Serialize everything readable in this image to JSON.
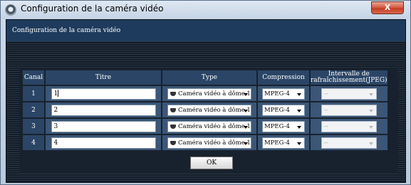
{
  "window": {
    "title": "Configuration de la caméra vidéo",
    "close_label": "X"
  },
  "page": {
    "title": "Configuration de la caméra vidéo"
  },
  "table": {
    "headers": {
      "canal": "Canal",
      "titre": "Titre",
      "type": "Type",
      "compression": "Compression",
      "intervalle": "Intervalle de rafraîchissement(JPEG)"
    },
    "rows": [
      {
        "canal": "1",
        "titre": "1",
        "type": "Caméra vidéo à dôme 1",
        "compression": "MPEG-4",
        "intervalle": "--"
      },
      {
        "canal": "2",
        "titre": "2",
        "type": "Caméra vidéo à dôme 1",
        "compression": "MPEG-4",
        "intervalle": "--"
      },
      {
        "canal": "3",
        "titre": "3",
        "type": "Caméra vidéo à dôme 1",
        "compression": "MPEG-4",
        "intervalle": "--"
      },
      {
        "canal": "4",
        "titre": "4",
        "type": "Caméra vidéo à dôme 1",
        "compression": "MPEG-4",
        "intervalle": "--"
      }
    ]
  },
  "buttons": {
    "ok": "OK"
  },
  "colors": {
    "header_bar": "#1e3b5d",
    "table_header": "#2b4566",
    "table_cell": "#3b5676",
    "close_button": "#c23d22"
  }
}
